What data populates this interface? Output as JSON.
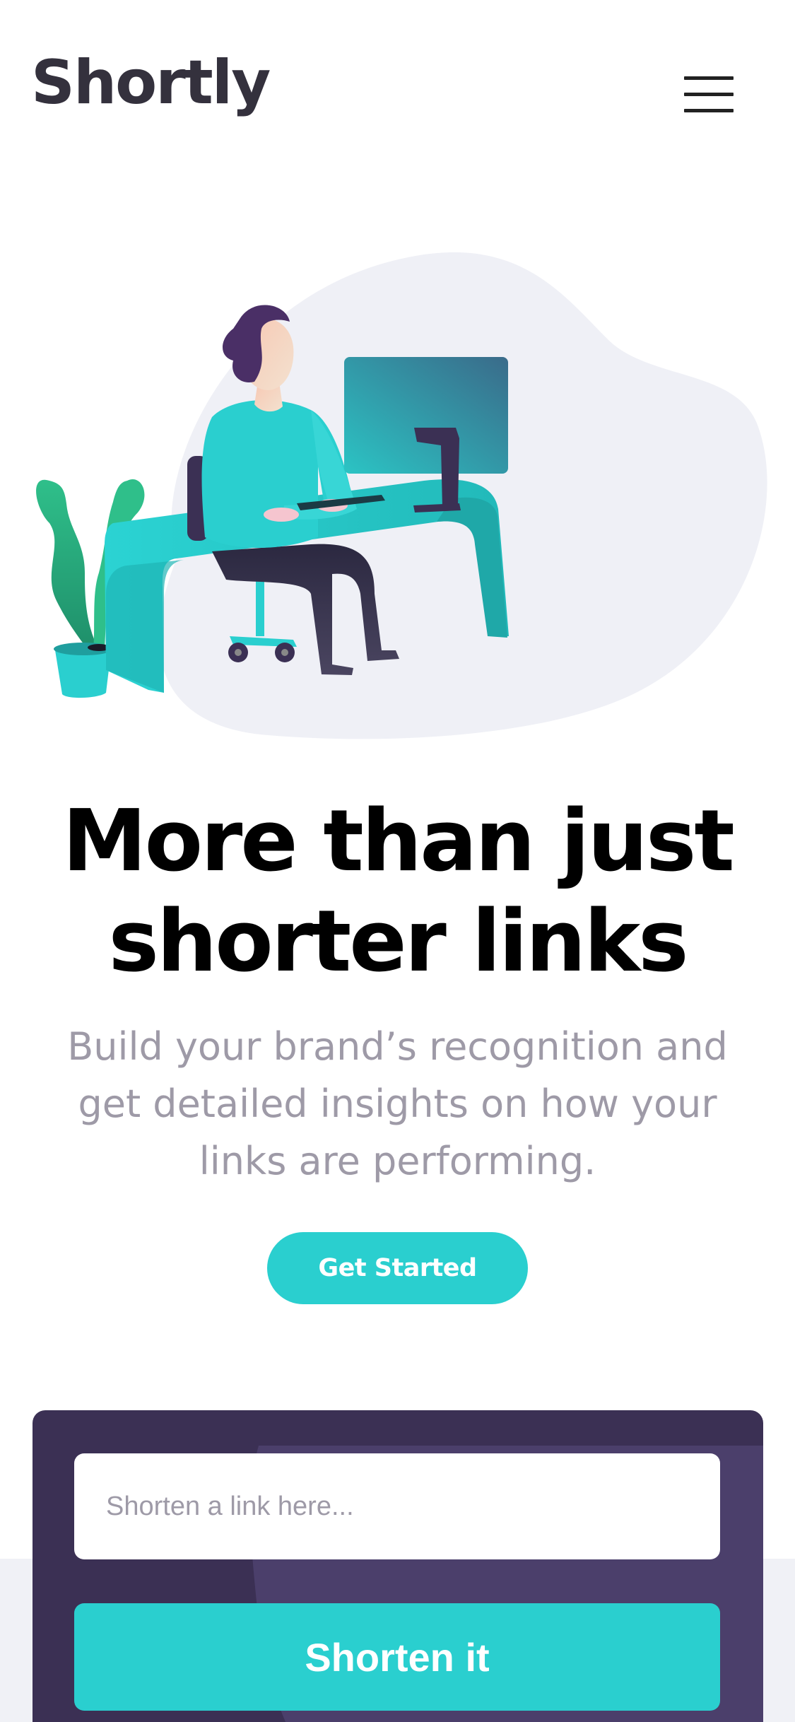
{
  "header": {
    "logo": "Shortly",
    "menu_icon": "hamburger-menu-icon"
  },
  "hero": {
    "illustration": "person-working-at-desk-illustration",
    "title": "More than just shorter links",
    "subtitle": "Build your brand’s recognition and get detailed insights on how your links are performing.",
    "cta_label": "Get Started"
  },
  "shorten": {
    "placeholder": "Shorten a link here...",
    "value": "",
    "button_label": "Shorten it"
  },
  "colors": {
    "primary_cyan": "#2acfcf",
    "dark_violet": "#3b3054",
    "very_dark_violet": "#232127",
    "grayish_violet": "#9e9aa7",
    "light_gray_bg": "#f0f1f6",
    "logo_color": "#34313d"
  }
}
